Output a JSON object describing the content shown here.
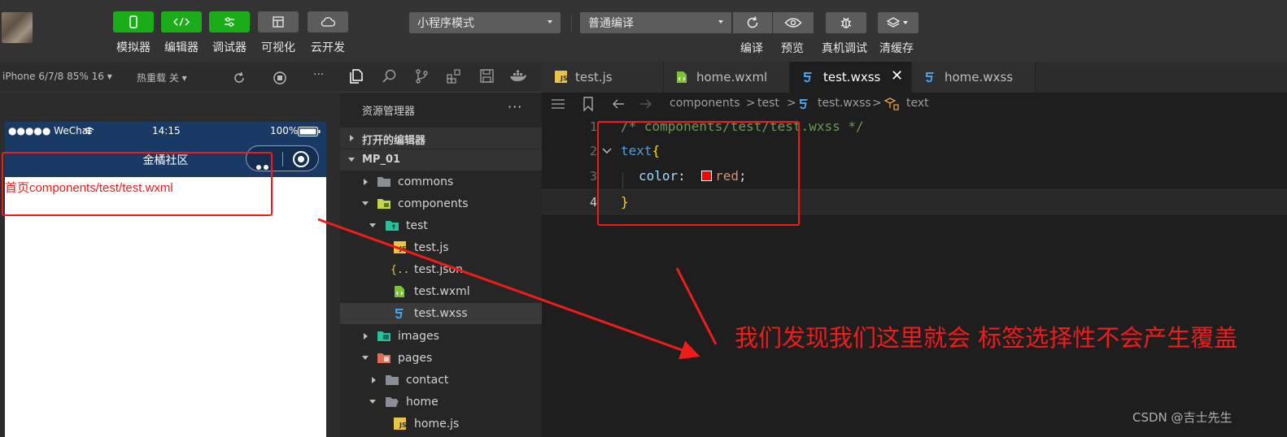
{
  "toolbar": {
    "simulator_label": "模拟器",
    "editor_label": "编辑器",
    "debugger_label": "调试器",
    "visual_label": "可视化",
    "cloud_label": "云开发",
    "mode_select": "小程序模式",
    "compile_select": "普通编译",
    "compile_label": "编译",
    "preview_label": "预览",
    "real_debug_label": "真机调试",
    "clear_cache_label": "清缓存"
  },
  "simbar": {
    "device": "iPhone 6/7/8 85% 16",
    "hot_reload": "热重载 关",
    "more": "···"
  },
  "phone": {
    "carrier": "●●●●● WeChat",
    "time": "14:15",
    "battery": "100%",
    "nav_title": "金橘社区",
    "page_text": "首页components/test/test.wxml"
  },
  "explorer": {
    "title": "资源管理器",
    "more": "···",
    "rows": [
      {
        "name": "打开的编辑器"
      },
      {
        "name": "MP_01"
      },
      {
        "name": "commons"
      },
      {
        "name": "components"
      },
      {
        "name": "test"
      },
      {
        "name": "test.js"
      },
      {
        "name": "test.json"
      },
      {
        "name": "test.wxml"
      },
      {
        "name": "test.wxss"
      },
      {
        "name": "images"
      },
      {
        "name": "pages"
      },
      {
        "name": "contact"
      },
      {
        "name": "home"
      },
      {
        "name": "home.js"
      }
    ]
  },
  "tabs": [
    {
      "name": "test.js"
    },
    {
      "name": "home.wxml"
    },
    {
      "name": "test.wxss"
    },
    {
      "name": "home.wxss"
    }
  ],
  "breadcrumb": {
    "seg1": "components",
    "sep1": ">",
    "seg2": "test",
    "sep2": ">",
    "seg3": "test.wxss",
    "sep3": ">",
    "seg4": "text"
  },
  "code": {
    "line_numbers": [
      "1",
      "2",
      "3",
      "4"
    ],
    "l1_comment": "/* components/test/test.wxss */",
    "l2_selector": "text",
    "l2_brace": "{",
    "l3_prop": "color",
    "l3_colon": ":",
    "l3_value": "red",
    "l3_semi": ";",
    "l4_brace": "}"
  },
  "annotation": {
    "text": "我们发现我们这里就会 标签选择性不会产生覆盖"
  },
  "watermark": "CSDN @吉士先生",
  "colors": {
    "accent_green": "#1aad19",
    "annotation_red": "#f01c1c",
    "phone_nav": "#1a3a66"
  }
}
